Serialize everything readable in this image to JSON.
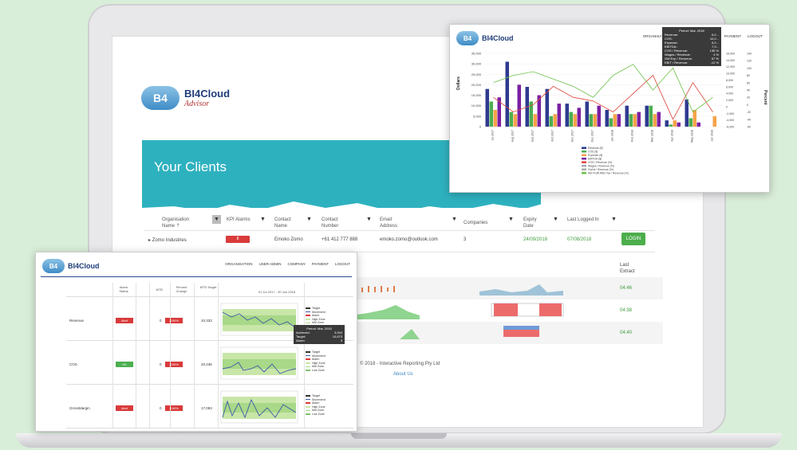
{
  "brand": {
    "logo_text": "B4",
    "name": "BI4Cloud",
    "sub": "Advisor"
  },
  "main": {
    "title": "Your Clients",
    "columns": [
      {
        "label": "Organisation Name ⇡"
      },
      {
        "label": "KPI Alarms"
      },
      {
        "label": "Contact Name"
      },
      {
        "label": "Contact Number"
      },
      {
        "label": "Email Address"
      },
      {
        "label": "Companies"
      },
      {
        "label": "Expiry Date"
      },
      {
        "label": "Last Logged In"
      }
    ],
    "row": {
      "org": "▸  Zomo Industries",
      "alarms": "8",
      "contact": "Emoko Zomo",
      "number": "+61 412 777 888",
      "email": "emoko.zomo@outlook.com",
      "companies": "3",
      "expiry": "24/09/2018",
      "last_login": "07/08/2018",
      "login_label": "LOGIN"
    },
    "last_extract_label": "Last Extract",
    "extract_times": [
      "04:46",
      "04:38",
      "04:40"
    ],
    "footer_copyright": "© 2018 - Interactive Reporting Pty Ltd",
    "footer_link": "About Us"
  },
  "chart_window": {
    "brand": "BI4Cloud",
    "nav": [
      "ORGANISATION",
      "PAYMENT",
      "LOGOUT"
    ],
    "tooltip_title": "Period: Mar, 2018",
    "tooltip_rows": [
      {
        "label": "Revenue:",
        "value": "6,0..."
      },
      {
        "label": "COS:",
        "value": "10,2..."
      },
      {
        "label": "Expense:",
        "value": "6,0..."
      },
      {
        "label": "EBITDA:",
        "value": "7,3..."
      },
      {
        "label": "COS / Revenue:",
        "value": "136 %"
      },
      {
        "label": "Wages / Revenue:",
        "value": "4 %"
      },
      {
        "label": "GM Exp / Revenue:",
        "value": "67 %"
      },
      {
        "label": "EBIT / Revenue:",
        "value": "-12 %"
      }
    ],
    "ylabel_left": "Dollars",
    "ylabel_right": "Percent",
    "y_ticks_left": [
      "35,000",
      "30,000",
      "25,000",
      "20,000",
      "15,000",
      "10,000",
      "5,000",
      "0"
    ],
    "y_ticks_right1": [
      "16,000",
      "14,000",
      "12,000",
      "10,000",
      "8,000",
      "6,000",
      "4,000",
      "2,000",
      "0",
      "-2,000",
      "-4,000",
      "-6,000"
    ],
    "y_ticks_right2": [
      "140",
      "120",
      "100",
      "80",
      "60",
      "40",
      "20",
      "0",
      "-20",
      "-40",
      "-60"
    ],
    "x_ticks": [
      "Jul 2017",
      "Aug 2017",
      "Sep 2017",
      "Oct 2017",
      "Nov 2017",
      "Dec 2017",
      "Jan 2018",
      "Feb 2018",
      "Mar 2018",
      "Apr 2018",
      "May 2018",
      "Jun 2018"
    ],
    "legend": [
      "Revenue ($)",
      "COS ($)",
      "Expense ($)",
      "EBITDA ($)",
      "COS / Revenue (%)",
      "Wages / Revenue (%)",
      "Ovrhd / Revenue (%)",
      "Net Profit After Tax / Revenue (%)"
    ],
    "colors": {
      "revenue": "#2f3a8f",
      "cos": "#4caf50",
      "expense": "#f5a34a",
      "ebitda": "#7b1fa2",
      "line_red": "#e0463c",
      "line_green": "#6cc24a"
    }
  },
  "chart_data": {
    "type": "bar",
    "categories": [
      "Jul 2017",
      "Aug 2017",
      "Sep 2017",
      "Oct 2017",
      "Nov 2017",
      "Dec 2017",
      "Jan 2018",
      "Feb 2018",
      "Mar 2018",
      "Apr 2018",
      "May 2018",
      "Jun 2018"
    ],
    "series": [
      {
        "name": "Revenue ($)",
        "values": [
          18000,
          31000,
          19000,
          18000,
          11000,
          12000,
          8000,
          10000,
          10000,
          3000,
          13000,
          0
        ]
      },
      {
        "name": "COS ($)",
        "values": [
          12000,
          7000,
          12000,
          5000,
          7000,
          6000,
          4000,
          6000,
          10000,
          1000,
          4000,
          0
        ]
      },
      {
        "name": "Expense ($)",
        "values": [
          8000,
          6000,
          6000,
          6000,
          6000,
          6000,
          6000,
          6000,
          6000,
          3000,
          8000,
          5000
        ]
      },
      {
        "name": "EBITDA ($)",
        "values": [
          14000,
          20000,
          15000,
          11000,
          9000,
          10000,
          6000,
          7000,
          7000,
          2000,
          2000,
          0
        ]
      }
    ],
    "ylabel": "Dollars",
    "ylim": [
      0,
      35000
    ]
  },
  "kpi_window": {
    "brand": "BI4Cloud",
    "nav": [
      "ORGANISATION",
      "USER ADMIN",
      "COMPANY",
      "PAYMENT",
      "LOGOUT"
    ],
    "headers": [
      "Alarm Status",
      "MTD",
      "Percent Change",
      "MTD Target",
      "01 Jul 2017 - 30 Jun 2018"
    ],
    "rows": [
      {
        "label": "Revenue",
        "status": "Alert",
        "status_color": "#d93a3a",
        "mtd": "0",
        "change": "-100%",
        "target": "10,333"
      },
      {
        "label": "COS",
        "status": "OK",
        "status_color": "#4caf50",
        "mtd": "0",
        "change": "-100%",
        "target": "20,436"
      },
      {
        "label": "GrossMargin",
        "status": "Alert",
        "status_color": "#d93a3a",
        "mtd": "0",
        "change": "-100%",
        "target": "17,083"
      }
    ],
    "spark_legend": [
      "Target",
      "Movement",
      "Alarm",
      "High Zone",
      "Mid Zone",
      "Low Zone"
    ],
    "tooltip_title": "Period: Mar, 2018",
    "tooltip_rows": [
      {
        "label": "Achieved:",
        "value": "3,004"
      },
      {
        "label": "Target:",
        "value": "10,673"
      },
      {
        "label": "Alarm:",
        "value": "3"
      }
    ]
  }
}
